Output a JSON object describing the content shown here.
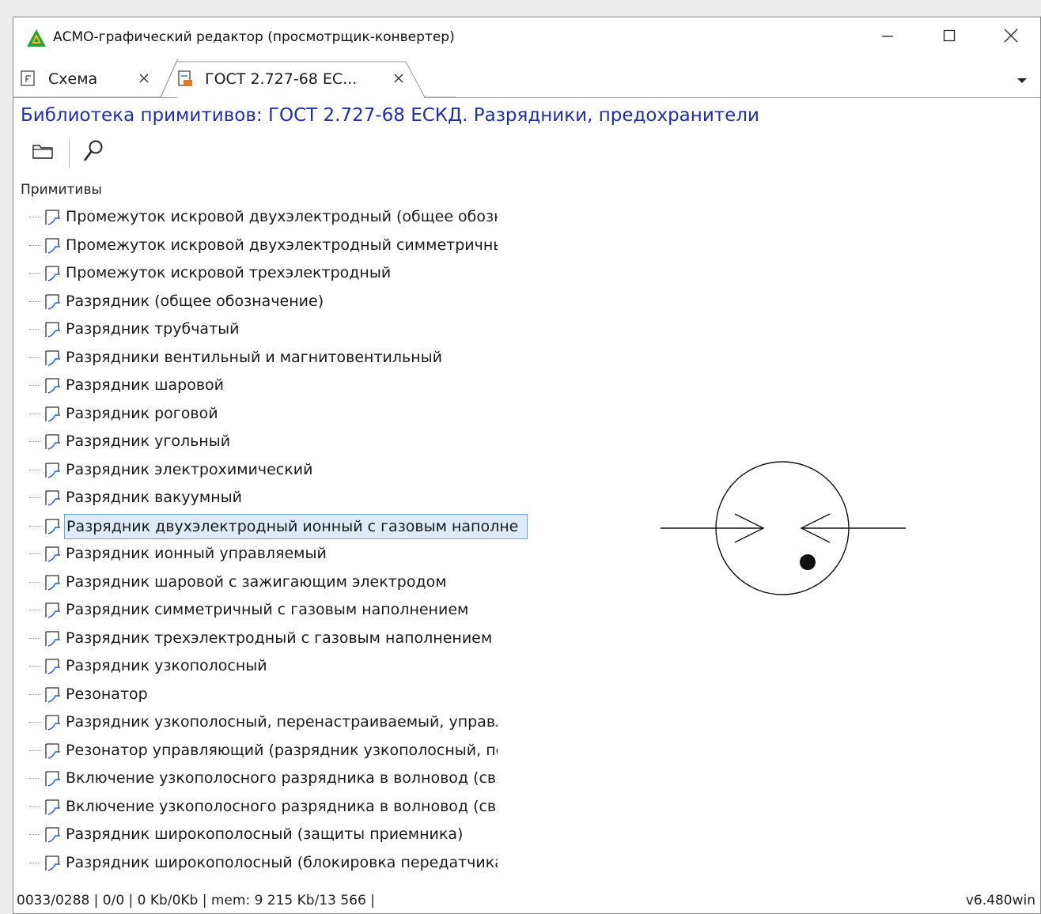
{
  "window": {
    "title": "АСМО-графический редактор (просмотрщик-конвертер)"
  },
  "tabs": [
    {
      "label": "Схема",
      "active": false
    },
    {
      "label": "ГОСТ 2.727-68 ЕС...",
      "active": true
    }
  ],
  "library": {
    "title": "Библиотека примитивов: ГОСТ 2.727-68 ЕСКД. Разрядники, предохранители"
  },
  "tree": {
    "root_label": "Примитивы",
    "selected_index": 11,
    "items": [
      "Промежуток искровой двухэлектродный (общее обозна",
      "Промежуток искровой двухэлектродный симметричный",
      "Промежуток искровой трехэлектродный",
      "Разрядник (общее обозначение)",
      "Разрядник трубчатый",
      "Разрядники вентильный и магнитовентильный",
      "Разрядник шаровой",
      "Разрядник роговой",
      "Разрядник угольный",
      "Разрядник электрохимический",
      "Разрядник вакуумный",
      "Разрядник двухэлектродный ионный с газовым наполне",
      "Разрядник ионный управляемый",
      "Разрядник шаровой с зажигающим электродом",
      "Разрядник симметричный с газовым наполнением",
      "Разрядник трехэлектродный с газовым наполнением",
      "Разрядник узкополосный",
      "Резонатор",
      "Разрядник узкополосный, перенастраиваемый, управляк",
      "Резонатор управляющий (разрядник узкополосный, пере",
      "Включение узкополосного разрядника в волновод (связı",
      "Включение узкополосного разрядника в волновод (связı",
      "Разрядник широкополосный (защиты приемника)",
      "Разрядник широкополосный (блокировка передатчика)"
    ]
  },
  "status": {
    "left": "0033/0288 | 0/0 |  0 Kb/0Kb | mem: 9 215 Kb/13 566 |",
    "right": "v6.480win"
  },
  "colors": {
    "title_blue": "#1f2ea6",
    "selection_bg": "#dceaf9",
    "selection_border": "#6ea3de",
    "app_icon_green": "#2e9e3a"
  },
  "icons": {
    "app": "app-logo-icon",
    "tab_schema": "schema-doc-icon",
    "tab_library": "library-doc-icon",
    "open_folder": "folder-icon",
    "search": "search-icon",
    "tree_item": "primitive-icon"
  }
}
